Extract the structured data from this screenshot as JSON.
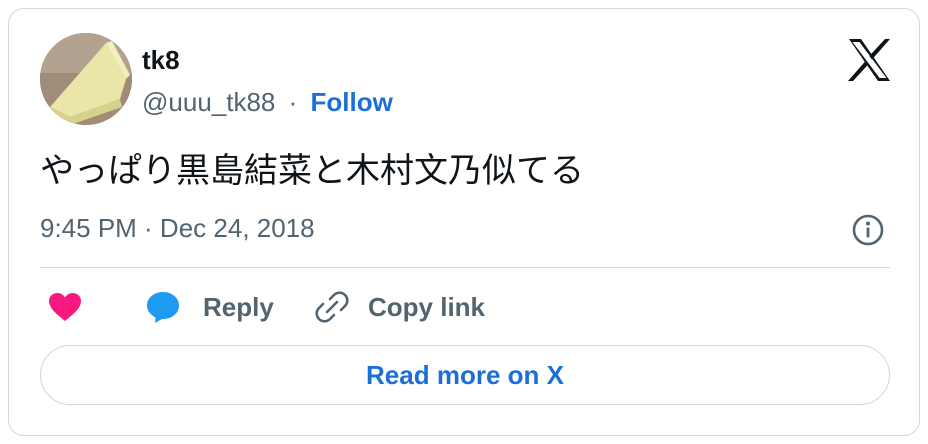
{
  "author": {
    "display_name": "tk8",
    "handle": "@uuu_tk88",
    "separator": "·",
    "follow_label": "Follow",
    "avatar_icon": "cheese-slice-avatar"
  },
  "header": {
    "logo_icon": "x-logo-icon"
  },
  "tweet": {
    "text": "やっぱり黒島結菜と木村文乃似てる",
    "timestamp": "9:45 PM · Dec 24, 2018",
    "info_icon": "info-icon"
  },
  "actions": {
    "like_icon": "heart-icon",
    "reply_icon": "speech-bubble-icon",
    "reply_label": "Reply",
    "copy_icon": "link-icon",
    "copy_label": "Copy link"
  },
  "footer": {
    "read_more_label": "Read more on X"
  },
  "colors": {
    "accent": "#1d6fd8",
    "heart": "#f91880",
    "reply_bubble": "#1d9bf0",
    "muted_text": "#536471",
    "border": "#cfd9de"
  }
}
